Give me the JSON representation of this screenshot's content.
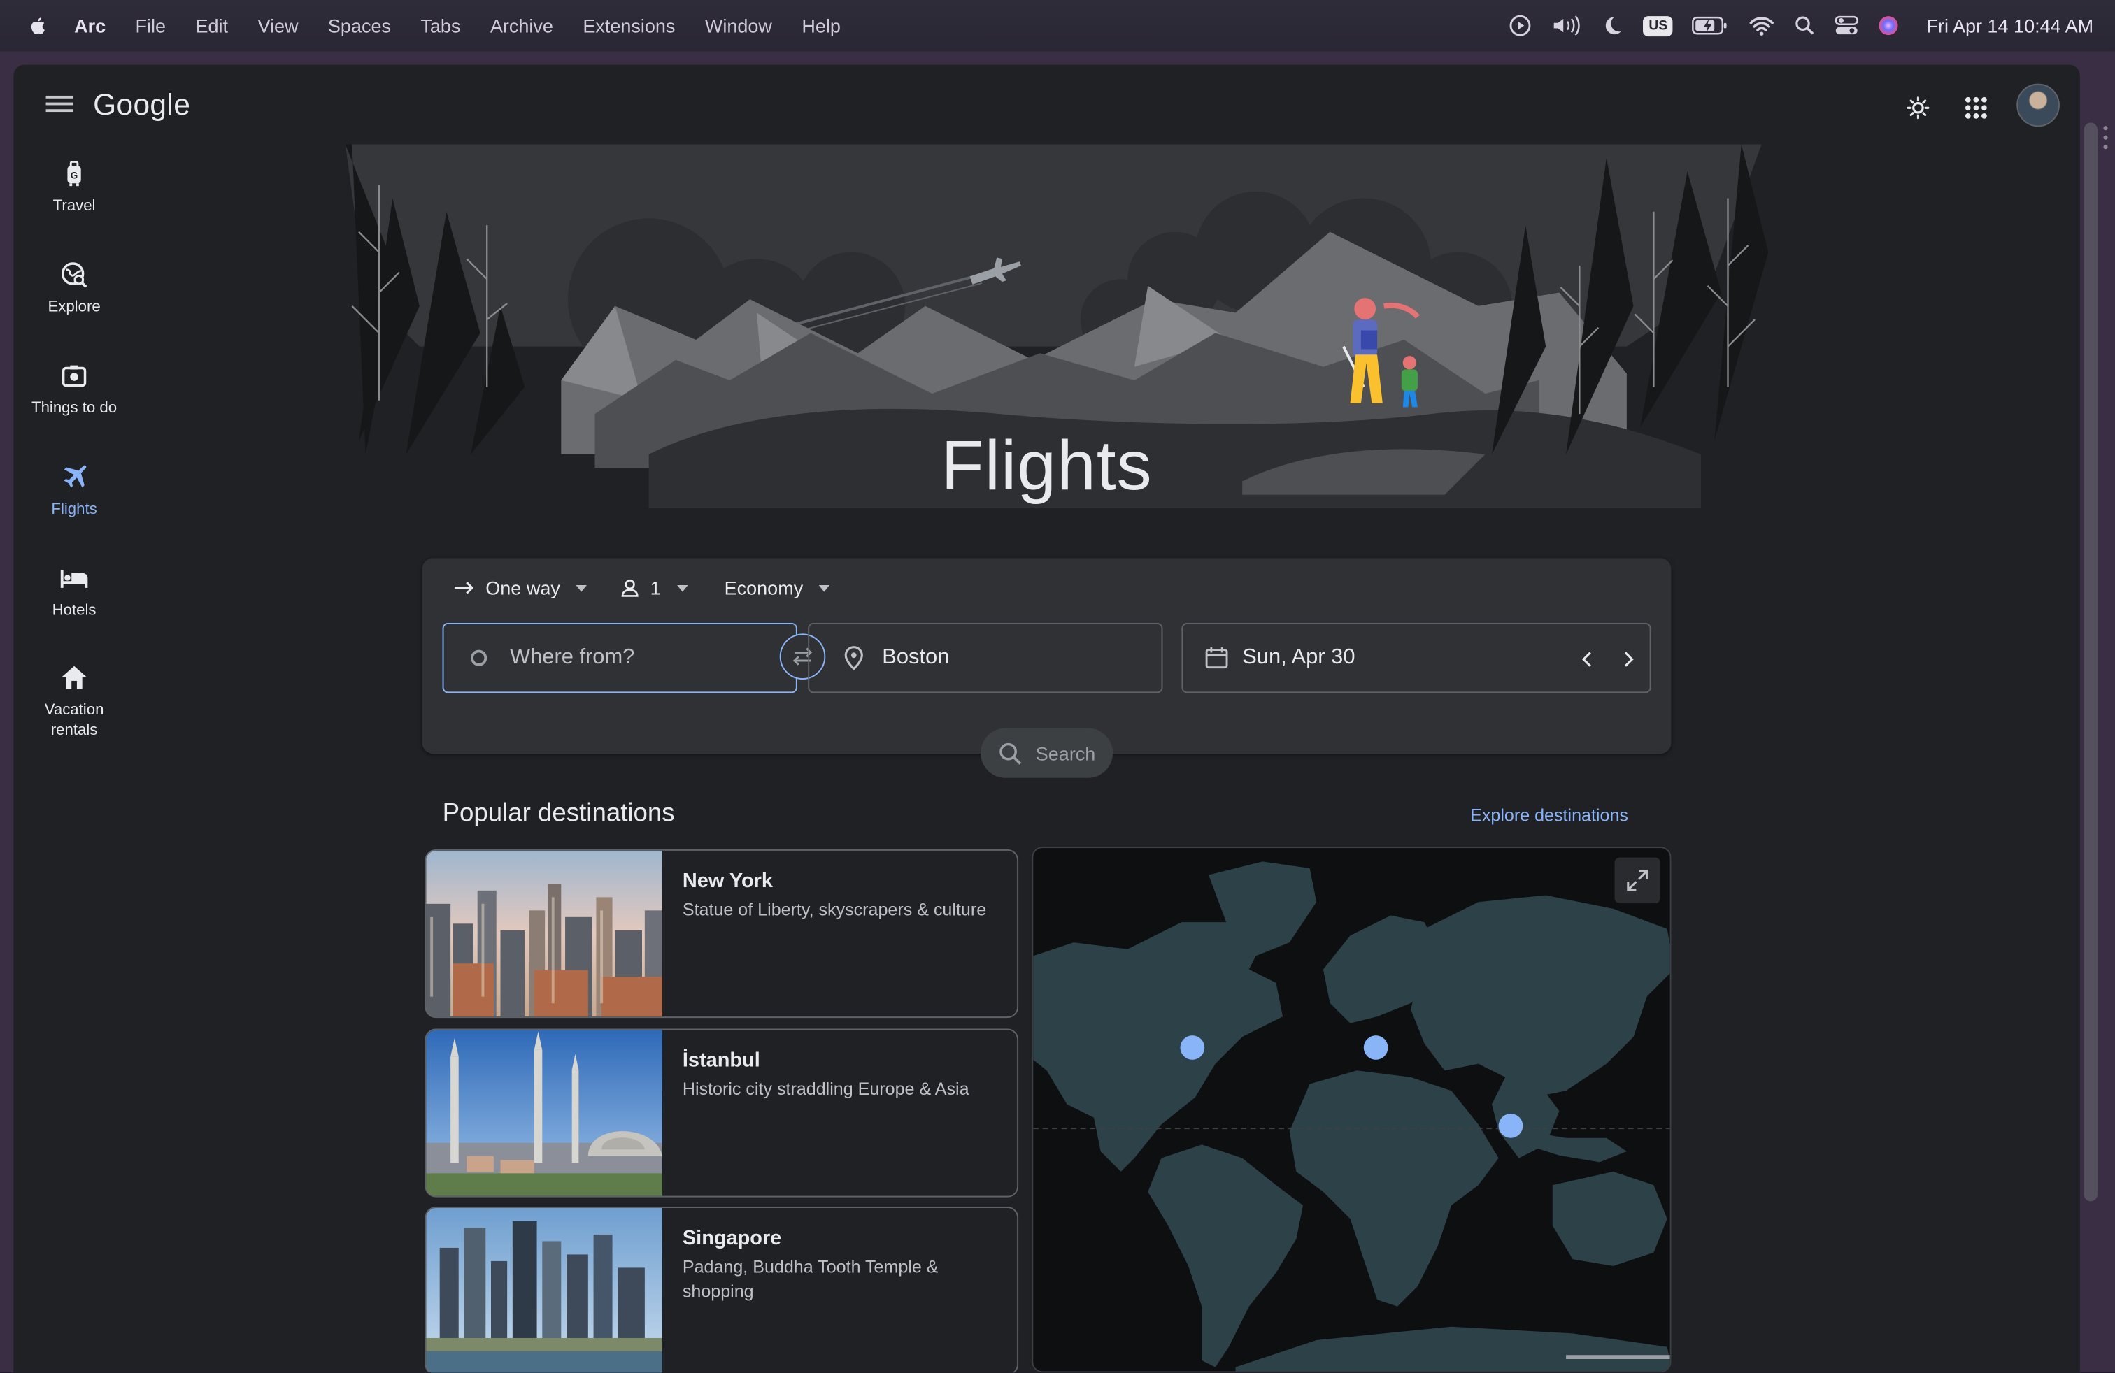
{
  "menubar": {
    "app": "Arc",
    "items": [
      "File",
      "Edit",
      "View",
      "Spaces",
      "Tabs",
      "Archive",
      "Extensions",
      "Window",
      "Help"
    ],
    "input_source": "US",
    "datetime": "Fri Apr 14  10:44 AM"
  },
  "header": {
    "logo": "Google"
  },
  "sidenav": [
    {
      "label": "Travel",
      "icon": "luggage-icon"
    },
    {
      "label": "Explore",
      "icon": "explore-globe-icon"
    },
    {
      "label": "Things to do",
      "icon": "camera-icon"
    },
    {
      "label": "Flights",
      "icon": "airplane-icon",
      "active": true
    },
    {
      "label": "Hotels",
      "icon": "bed-icon"
    },
    {
      "label": "Vacation rentals",
      "icon": "house-icon"
    }
  ],
  "hero": {
    "title": "Flights"
  },
  "search": {
    "trip_type": "One way",
    "passengers": "1",
    "cabin_class": "Economy",
    "from_placeholder": "Where from?",
    "to_value": "Boston",
    "date_value": "Sun, Apr 30",
    "search_label": "Search"
  },
  "popular": {
    "title": "Popular destinations",
    "explore_link": "Explore destinations",
    "destinations": [
      {
        "name": "New York",
        "desc": "Statue of Liberty, skyscrapers & culture"
      },
      {
        "name": "İstanbul",
        "desc": "Historic city straddling Europe & Asia"
      },
      {
        "name": "Singapore",
        "desc": "Padang, Buddha Tooth Temple & shopping"
      }
    ]
  },
  "colors": {
    "background": "#202124",
    "accent": "#8ab4f8",
    "card_border": "#5f6368",
    "text": "#e8eaed"
  }
}
